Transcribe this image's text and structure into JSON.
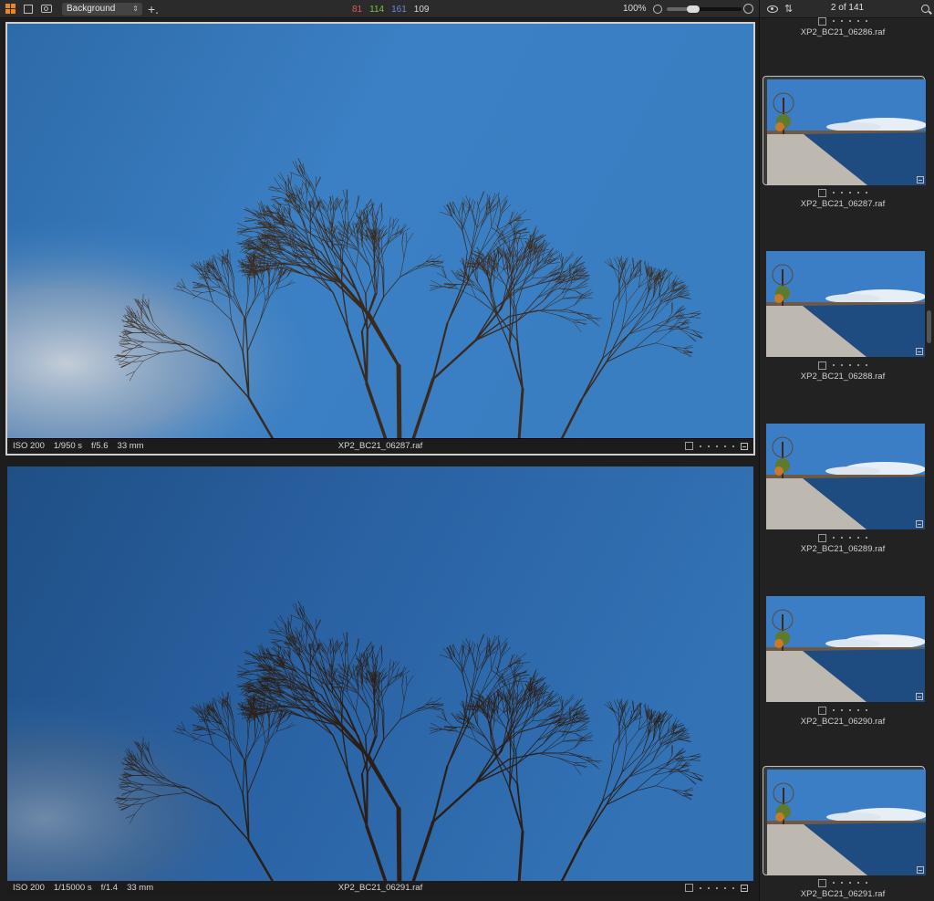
{
  "toolbar": {
    "view_select": "Background",
    "counts": [
      {
        "value": "81",
        "color": "#e05a4f"
      },
      {
        "value": "114",
        "color": "#7bc043"
      },
      {
        "value": "161",
        "color": "#6f86e0"
      },
      {
        "value": "109",
        "color": "#d6d6d6"
      }
    ],
    "zoom": "100%",
    "zoom_level": 0.35
  },
  "viewer": {
    "top": {
      "iso": "ISO 200",
      "shutter": "1/950 s",
      "aperture": "f/5.6",
      "focal": "33 mm",
      "filename": "XP2_BC21_06287.raf"
    },
    "bottom": {
      "iso": "ISO 200",
      "shutter": "1/15000 s",
      "aperture": "f/1.4",
      "focal": "33 mm",
      "filename": "XP2_BC21_06291.raf"
    }
  },
  "sidebar": {
    "page_count": "2 of 141",
    "thumbnails": [
      {
        "filename": "XP2_BC21_06286.raf"
      },
      {
        "filename": "XP2_BC21_06287.raf"
      },
      {
        "filename": "XP2_BC21_06288.raf"
      },
      {
        "filename": "XP2_BC21_06289.raf"
      },
      {
        "filename": "XP2_BC21_06290.raf"
      },
      {
        "filename": "XP2_BC21_06291.raf"
      }
    ]
  },
  "colors": {
    "accent": "#e8862a",
    "sky_bright": "#3a7dc2",
    "sky_dark": "#24578f"
  }
}
